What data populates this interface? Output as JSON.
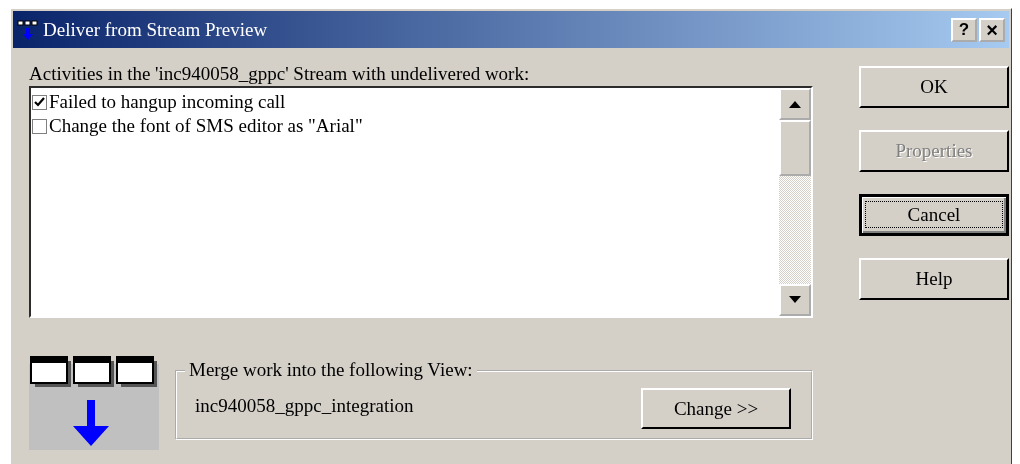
{
  "window": {
    "title": "Deliver from Stream Preview",
    "title_buttons": [
      {
        "kind": "help",
        "label": "?"
      },
      {
        "kind": "close",
        "label": "×"
      }
    ]
  },
  "list_label": "Activities in the 'inc940058_gppc' Stream with undelivered work:",
  "activities": [
    {
      "label": "Failed to hangup incoming call",
      "checked": true
    },
    {
      "label": "Change the font of SMS editor as \"Arial\"",
      "checked": false
    }
  ],
  "buttons": [
    {
      "label": "OK",
      "disabled": false,
      "focused": false
    },
    {
      "label": "Properties",
      "disabled": true,
      "focused": false
    },
    {
      "label": "Cancel",
      "disabled": false,
      "focused": true
    },
    {
      "label": "Help",
      "disabled": false,
      "focused": false
    }
  ],
  "merge": {
    "label": "Merge work into the following View:",
    "view": "inc940058_gppc_integration",
    "change_button": "Change >>"
  }
}
